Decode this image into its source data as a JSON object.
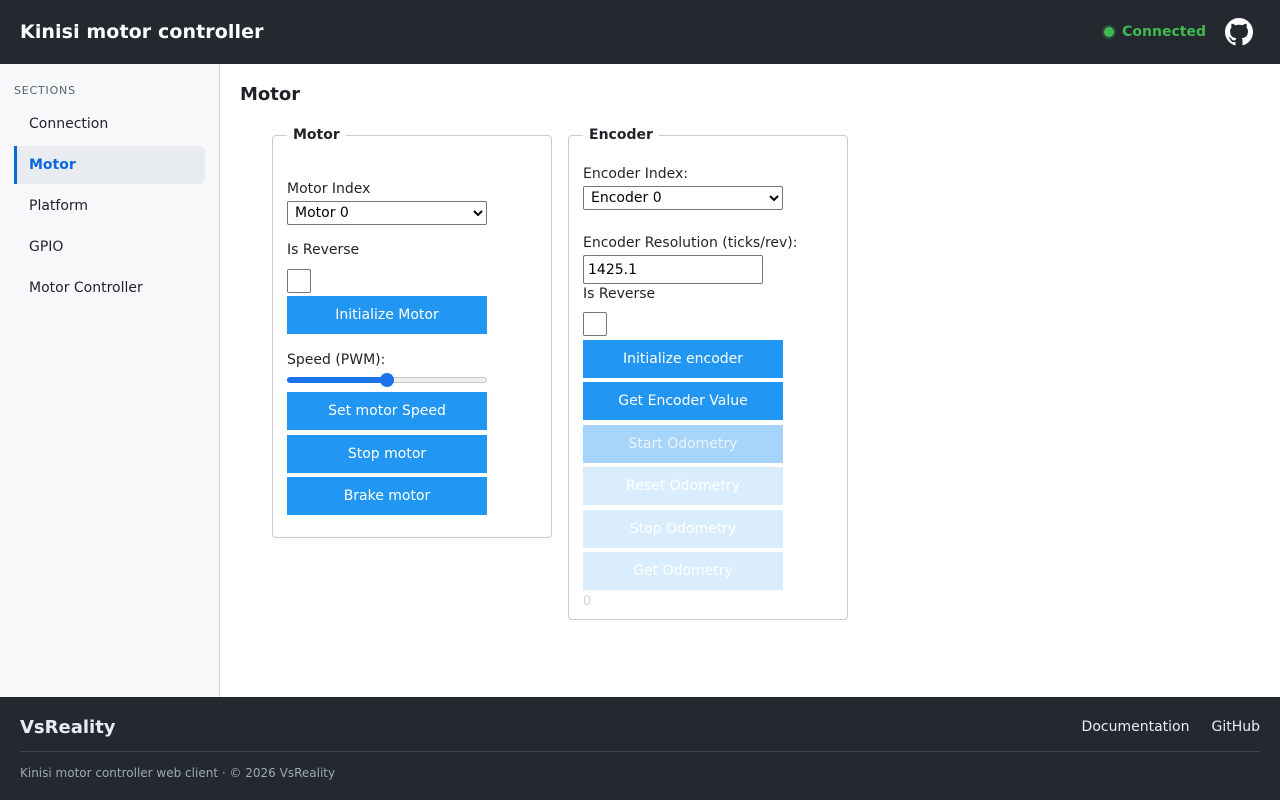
{
  "header": {
    "title": "Kinisi motor controller",
    "status": "Connected",
    "github_icon": "github-icon",
    "status_color": "#3fb950"
  },
  "sidebar": {
    "heading": "SECTIONS",
    "items": [
      {
        "label": "Connection",
        "active": false
      },
      {
        "label": "Motor",
        "active": true
      },
      {
        "label": "Platform",
        "active": false
      },
      {
        "label": "GPIO",
        "active": false
      },
      {
        "label": "Motor Controller",
        "active": false
      }
    ]
  },
  "main": {
    "title": "Motor",
    "motor": {
      "legend": "Motor",
      "index_label": "Motor Index",
      "index_value": "Motor 0",
      "reverse_label": "Is Reverse",
      "reverse_checked": false,
      "init_button": "Initialize Motor",
      "speed_label": "Speed (PWM):",
      "speed_fraction": 0.5,
      "set_speed_button": "Set motor Speed",
      "stop_button": "Stop motor",
      "brake_button": "Brake motor"
    },
    "encoder": {
      "legend": "Encoder",
      "index_label": "Encoder Index:",
      "index_value": "Encoder 0",
      "resolution_label": "Encoder Resolution (ticks/rev):",
      "resolution_value": "1425.1",
      "reverse_label": "Is Reverse",
      "reverse_checked": false,
      "init_button": "Initialize encoder",
      "get_value_button": "Get Encoder Value",
      "start_odometry_button": "Start Odometry",
      "reset_odometry_button": "Reset Odometry",
      "stop_odometry_button": "Stop Odometry",
      "get_odometry_button": "Get Odometry",
      "odometry_value": "0"
    }
  },
  "footer": {
    "brand": "VsReality",
    "links": [
      "Documentation",
      "GitHub"
    ],
    "copyright": "Kinisi motor controller web client · © 2026 VsReality"
  },
  "colors": {
    "header_bg": "#24292f",
    "accent": "#0969da",
    "button": "#2196f3"
  }
}
